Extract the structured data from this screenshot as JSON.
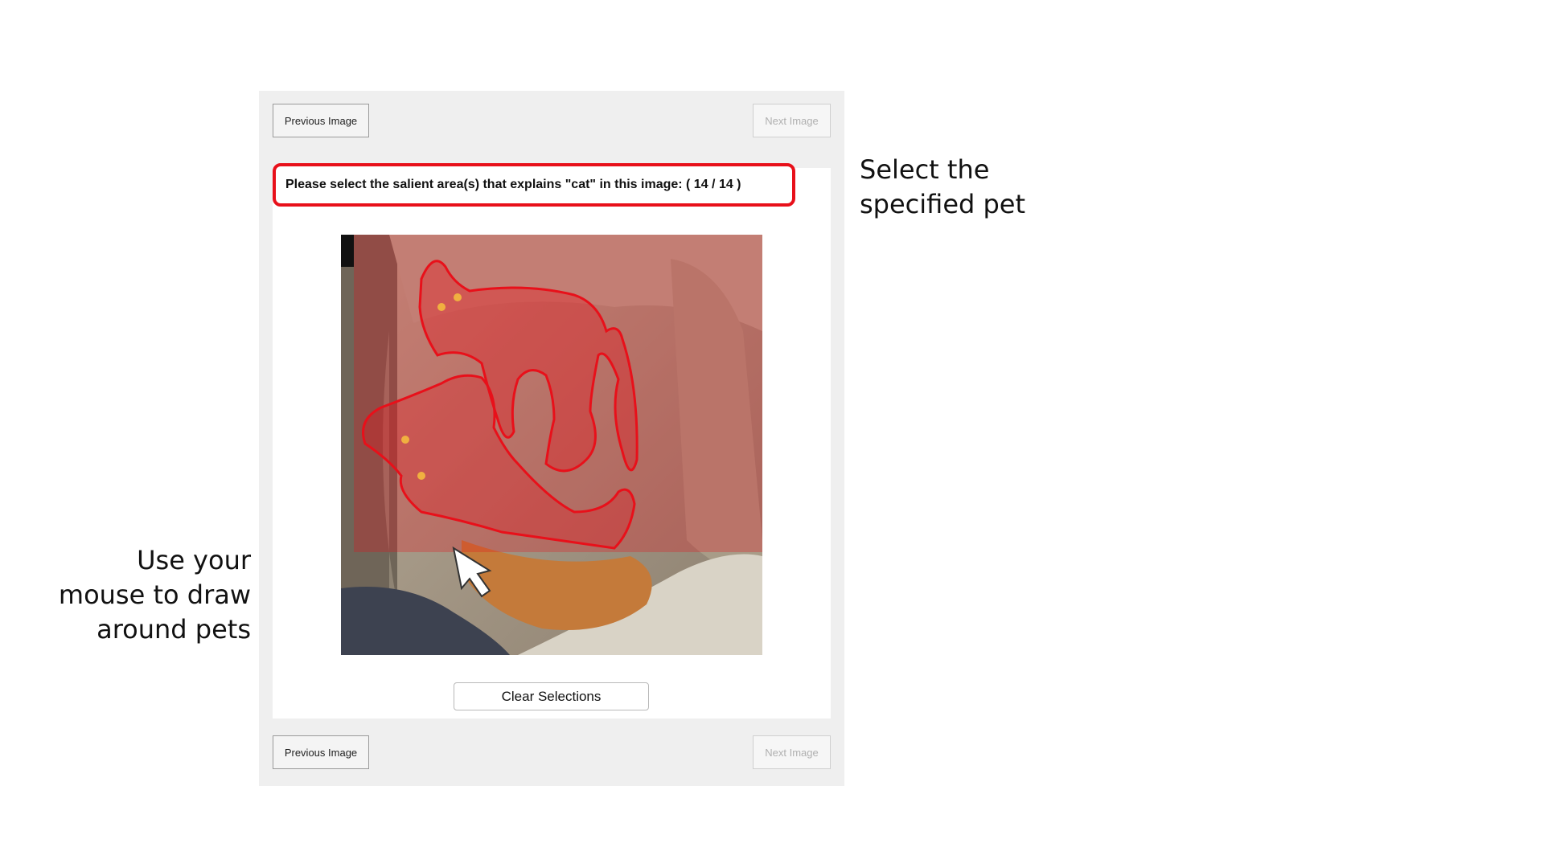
{
  "nav": {
    "previous_label": "Previous Image",
    "next_label": "Next Image"
  },
  "prompt": {
    "text": "Please select the salient area(s) that explains \"cat\" in this image: ( 14 / 14 )"
  },
  "image": {
    "selection_color": "#e8101a"
  },
  "clear_label": "Clear Selections",
  "annotations": {
    "right_line1": "Select the",
    "right_line2": "specified pet",
    "left_line1": "Use your",
    "left_line2": "mouse to draw",
    "left_line3": "around pets"
  }
}
